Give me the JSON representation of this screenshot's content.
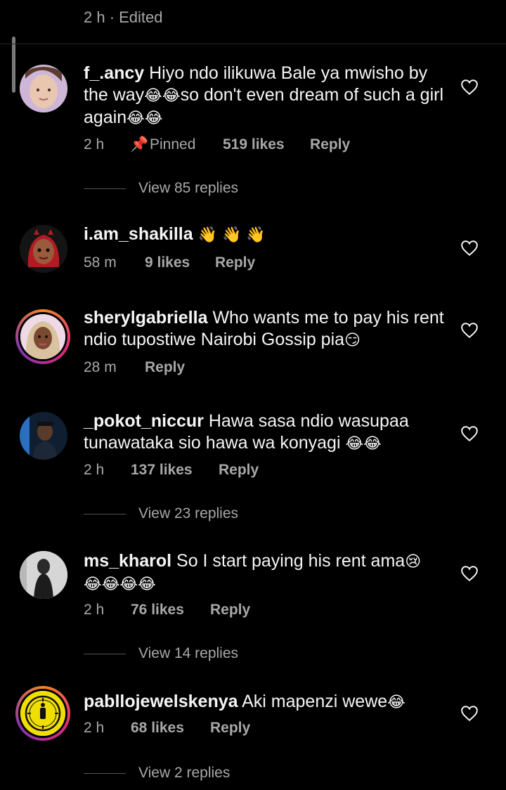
{
  "top": {
    "meta": "2 h · Edited"
  },
  "comments": [
    {
      "username": "f_.ancy",
      "text": "Hiyo ndo ilikuwa Bale ya mwisho by the way",
      "emoji_a": "😂😂",
      "text2": "so don't even dream of such a girl again",
      "emoji_b": "😂😂",
      "time": "2 h",
      "pinned": "Pinned",
      "likes": "519 likes",
      "reply": "Reply",
      "view_replies": "View 85 replies"
    },
    {
      "username": "i.am_shakilla",
      "text": "",
      "emoji_a": "👋 👋 👋",
      "time": "58 m",
      "likes": "9 likes",
      "reply": "Reply"
    },
    {
      "username": "sherylgabriella",
      "text": "Who wants me to pay his rent ndio tupostiwe Nairobi Gossip pia",
      "emoji_a": "😏",
      "time": "28 m",
      "reply": "Reply"
    },
    {
      "username": "_pokot_niccur",
      "text": "Hawa sasa ndio wasupaa tunawataka sio hawa wa konyagi",
      "emoji_a": "😂😂",
      "time": "2 h",
      "likes": "137 likes",
      "reply": "Reply",
      "view_replies": "View 23 replies"
    },
    {
      "username": "ms_kharol",
      "text": "So I start paying his rent ama",
      "emoji_a": "😢",
      "emoji_b": "😂😂😂😂",
      "time": "2 h",
      "likes": "76 likes",
      "reply": "Reply",
      "view_replies": "View 14 replies"
    },
    {
      "username": "pabllojewelskenya",
      "text": "Aki mapenzi wewe",
      "emoji_a": "😂",
      "time": "2 h",
      "likes": "68 likes",
      "reply": "Reply",
      "view_replies": "View 2 replies"
    }
  ],
  "colors": {
    "background": "#000000",
    "text": "#f5f5f5",
    "muted": "#a8a8a8",
    "story_ring": "#dd2a7b"
  }
}
